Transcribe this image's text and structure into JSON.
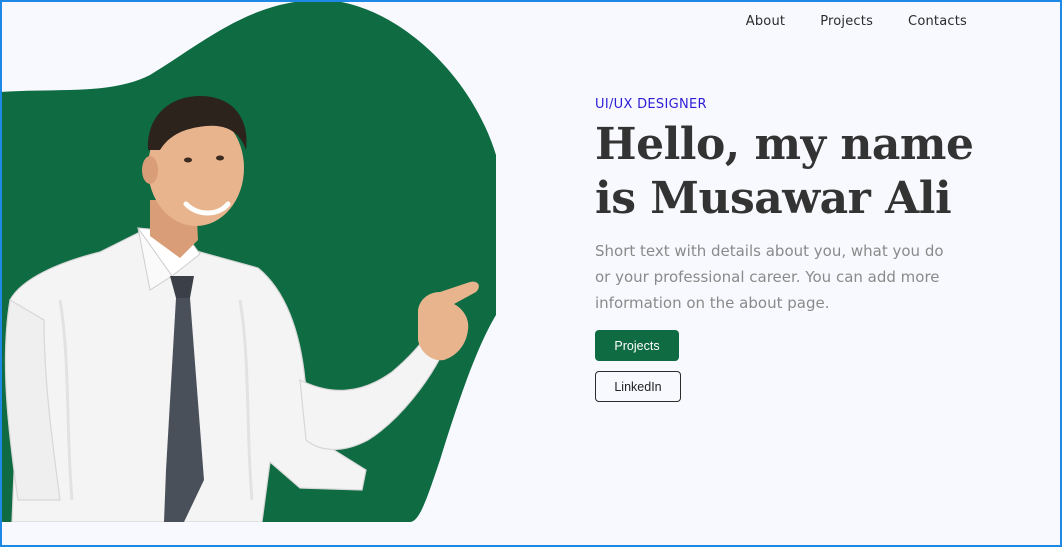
{
  "nav": {
    "items": [
      {
        "label": "About"
      },
      {
        "label": "Projects"
      },
      {
        "label": "Contacts"
      }
    ]
  },
  "hero": {
    "role": "UI/UX DESIGNER",
    "headline": "Hello,  my name\nis Musawar Ali",
    "intro": "Short text with details about you, what you do or your professional career. You can add more information on the about page.",
    "primary_button_label": "Projects",
    "secondary_button_label": "LinkedIn"
  },
  "colors": {
    "accent_green": "#0e6b42",
    "role_blue": "#2d1dd6",
    "background": "#f8f9fe",
    "frame_border": "#1e88e5"
  },
  "icons": {
    "portrait": "person-pointing-photo"
  }
}
